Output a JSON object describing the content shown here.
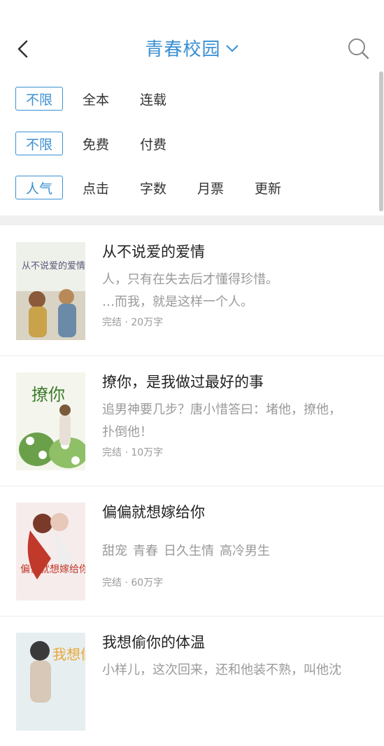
{
  "header": {
    "title": "青春校园"
  },
  "filters": {
    "row1": {
      "selected": "不限",
      "options": [
        "全本",
        "连载"
      ]
    },
    "row2": {
      "selected": "不限",
      "options": [
        "免费",
        "付费"
      ]
    },
    "row3": {
      "selected": "人气",
      "options": [
        "点击",
        "字数",
        "月票",
        "更新"
      ]
    }
  },
  "books": [
    {
      "title": "从不说爱的爱情",
      "desc_line1": "人，只有在失去后才懂得珍惜。",
      "desc_line2": "…而我，就是这样一个人。",
      "meta": "完结 · 20万字",
      "cover_text": "从不说爱的爱情"
    },
    {
      "title": "撩你，是我做过最好的事",
      "desc_line1": "追男神要几步？唐小惜答曰：堵他，撩他，",
      "desc_line2": "扑倒他！",
      "meta": "完结 · 10万字",
      "cover_text": "撩你"
    },
    {
      "title": "偏偏就想嫁给你",
      "tags": [
        "甜宠",
        "青春",
        "日久生情",
        "高冷男生"
      ],
      "meta": "完结 · 60万字",
      "cover_text": "偏偏就想嫁给你"
    },
    {
      "title": "我想偷你的体温",
      "desc_line1": "小样儿，这次回来，还和他装不熟，叫他沈",
      "cover_text": "我想偷"
    }
  ]
}
